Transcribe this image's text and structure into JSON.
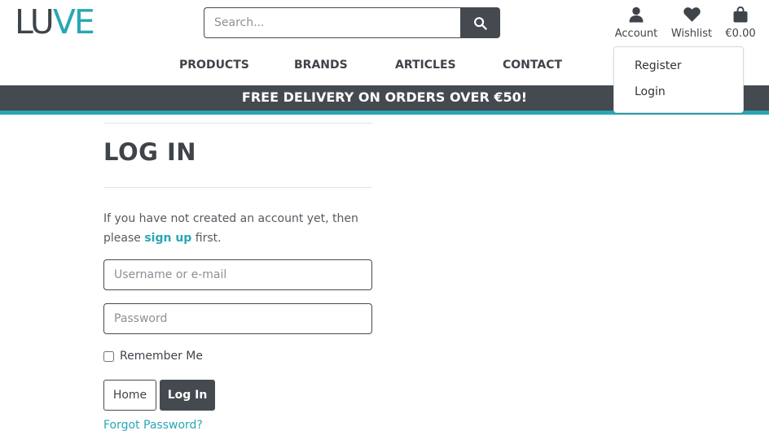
{
  "header": {
    "logo_part1": "LU",
    "logo_part2": "VE",
    "search": {
      "placeholder": "Search..."
    },
    "account_label": "Account",
    "wishlist_label": "Wishlist",
    "cart_total": "€0.00"
  },
  "nav": {
    "items": [
      {
        "label": "PRODUCTS"
      },
      {
        "label": "BRANDS"
      },
      {
        "label": "ARTICLES"
      },
      {
        "label": "CONTACT"
      }
    ]
  },
  "banner": {
    "text": "FREE DELIVERY ON ORDERS OVER €50!"
  },
  "account_dropdown": {
    "items": [
      {
        "label": "Register"
      },
      {
        "label": "Login"
      }
    ]
  },
  "login": {
    "title": "LOG IN",
    "intro_before": "If you have not created an account yet, then please ",
    "signup_link": "sign up",
    "intro_after": " first.",
    "username_placeholder": "Username or e-mail",
    "password_placeholder": "Password",
    "remember_label": "Remember Me",
    "home_button": "Home",
    "login_button": "Log In",
    "forgot_link": "Forgot Password?"
  },
  "colors": {
    "brand_dark": "#444a50",
    "accent": "#29a6b4"
  },
  "icons": {
    "search": "search-icon",
    "account": "user-icon",
    "wishlist": "heart-icon",
    "cart": "shopping-bag-icon"
  }
}
